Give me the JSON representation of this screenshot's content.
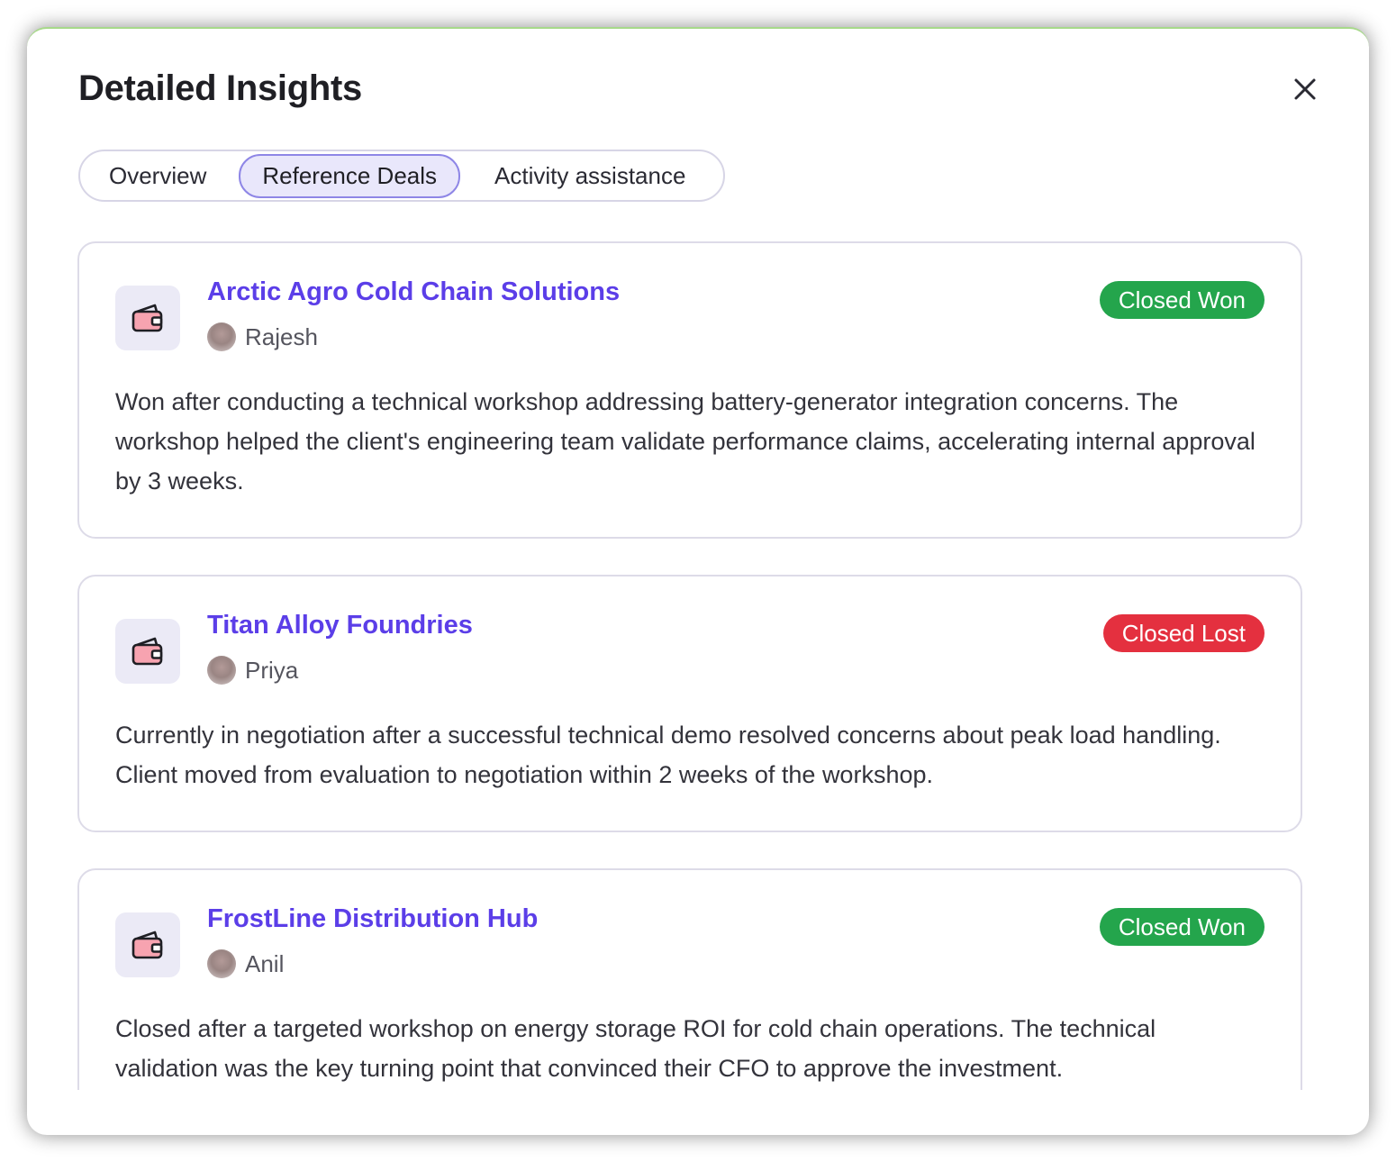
{
  "modal": {
    "title": "Detailed Insights"
  },
  "tabs": [
    {
      "label": "Overview",
      "active": false
    },
    {
      "label": "Reference Deals",
      "active": true
    },
    {
      "label": "Activity assistance",
      "active": false
    }
  ],
  "deals": [
    {
      "name": "Arctic Agro Cold Chain Solutions",
      "owner": "Rajesh",
      "status": "Closed Won",
      "description": "Won after conducting a technical workshop addressing battery-generator integration concerns. The workshop helped the client's engineering team validate performance claims, accelerating internal approval by 3 weeks."
    },
    {
      "name": "Titan Alloy Foundries",
      "owner": "Priya",
      "status": "Closed Lost",
      "description": "Currently in negotiation after a successful technical demo resolved concerns about peak load handling. Client moved from evaluation to negotiation within 2 weeks of the workshop."
    },
    {
      "name": "FrostLine Distribution Hub",
      "owner": "Anil",
      "status": "Closed Won",
      "description": "Closed after a targeted workshop on energy storage ROI for cold chain operations. The technical validation was the key turning point that convinced their CFO to approve the investment."
    }
  ],
  "icons": {
    "close": "close-icon",
    "deal": "wallet-icon"
  },
  "colors": {
    "deal_link": "#5b3ee8",
    "closed_won": "#24a54c",
    "closed_lost": "#e4303f",
    "active_tab_bg": "#e9e7fb",
    "icon_bg": "#ebeaf6",
    "wallet_fill": "#f7a3b0"
  }
}
